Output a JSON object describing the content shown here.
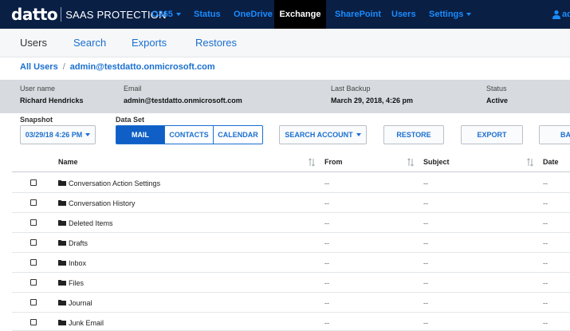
{
  "brand": {
    "logo": "datto",
    "product": "SAAS PROTECTION"
  },
  "topnav": {
    "items": [
      {
        "label": "O365",
        "dropdown": true
      },
      {
        "label": "Status"
      },
      {
        "label": "OneDrive"
      },
      {
        "label": "Exchange",
        "active": true
      },
      {
        "label": "SharePoint"
      },
      {
        "label": "Users"
      },
      {
        "label": "Settings",
        "dropdown": true
      }
    ],
    "user_label": "ad"
  },
  "subtabs": [
    "Users",
    "Search",
    "Exports",
    "Restores"
  ],
  "breadcrumb": {
    "root": "All Users",
    "separator": "/",
    "current": "admin@testdatto.onmicrosoft.com"
  },
  "info": {
    "username_label": "User name",
    "username": "Richard Hendricks",
    "email_label": "Email",
    "email": "admin@testdatto.onmicrosoft.com",
    "backup_label": "Last Backup",
    "backup": "March 29, 2018, 4:26 pm",
    "status_label": "Status",
    "status": "Active"
  },
  "controls": {
    "snapshot_label": "Snapshot",
    "snapshot_value": "03/29/18 4:26 PM",
    "dataset_label": "Data Set",
    "dataset": [
      "MAIL",
      "CONTACTS",
      "CALENDAR"
    ],
    "search_account": "SEARCH ACCOUNT",
    "restore": "RESTORE",
    "export": "EXPORT",
    "extra": "BA"
  },
  "table": {
    "columns": [
      "Name",
      "From",
      "Subject",
      "Date"
    ],
    "rows": [
      {
        "name": "Conversation Action Settings",
        "from": "--",
        "subject": "--",
        "date": "--"
      },
      {
        "name": "Conversation History",
        "from": "--",
        "subject": "--",
        "date": "--"
      },
      {
        "name": "Deleted Items",
        "from": "--",
        "subject": "--",
        "date": "--"
      },
      {
        "name": "Drafts",
        "from": "--",
        "subject": "--",
        "date": "--"
      },
      {
        "name": "Inbox",
        "from": "--",
        "subject": "--",
        "date": "--"
      },
      {
        "name": "Files",
        "from": "--",
        "subject": "--",
        "date": "--"
      },
      {
        "name": "Journal",
        "from": "--",
        "subject": "--",
        "date": "--"
      },
      {
        "name": "Junk Email",
        "from": "--",
        "subject": "--",
        "date": "--"
      }
    ]
  },
  "colors": {
    "navbar": "#0a1f44",
    "link": "#1a8cff",
    "accent": "#0f5fc6",
    "infoband": "#d7dbe0"
  }
}
